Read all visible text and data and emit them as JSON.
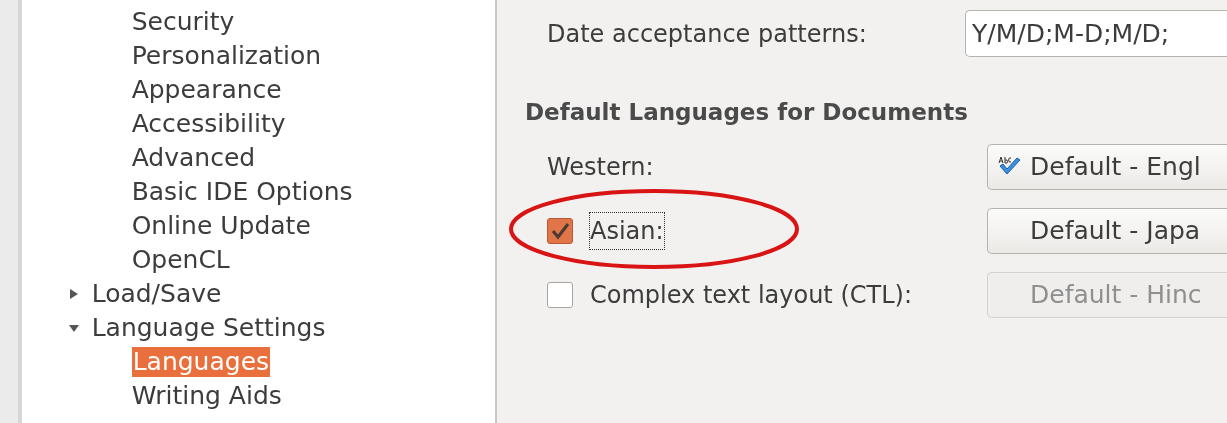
{
  "tree": [
    {
      "label": "Security",
      "selected": false
    },
    {
      "label": "Personalization",
      "selected": false
    },
    {
      "label": "Appearance",
      "selected": false
    },
    {
      "label": "Accessibility",
      "selected": false
    },
    {
      "label": "Advanced",
      "selected": false
    },
    {
      "label": "Basic IDE Options",
      "selected": false
    },
    {
      "label": "Online Update",
      "selected": false
    },
    {
      "label": "OpenCL",
      "selected": false
    },
    {
      "label": "Load/Save",
      "selected": false,
      "expanded": false
    },
    {
      "label": "Language Settings",
      "selected": false,
      "expanded": true,
      "children": [
        {
          "label": "Languages",
          "selected": true
        },
        {
          "label": "Writing Aids",
          "selected": false
        }
      ]
    }
  ],
  "date_patterns": {
    "label": "Date acceptance patterns:",
    "value": "Y/M/D;M-D;M/D;"
  },
  "section": {
    "title": "Default Languages for Documents",
    "rows": [
      {
        "kind": "label",
        "label": "Western:",
        "value": "Default - Engl",
        "spellcheck": true,
        "disabled": false
      },
      {
        "kind": "checkbox",
        "label": "Asian:",
        "checked": true,
        "focused": true,
        "highlighted": true,
        "value": "Default - Japa",
        "spellcheck": false,
        "disabled": false
      },
      {
        "kind": "checkbox",
        "label": "Complex text layout (CTL):",
        "checked": false,
        "focused": false,
        "highlighted": false,
        "value": "Default - Hinc",
        "spellcheck": false,
        "disabled": true
      }
    ]
  }
}
